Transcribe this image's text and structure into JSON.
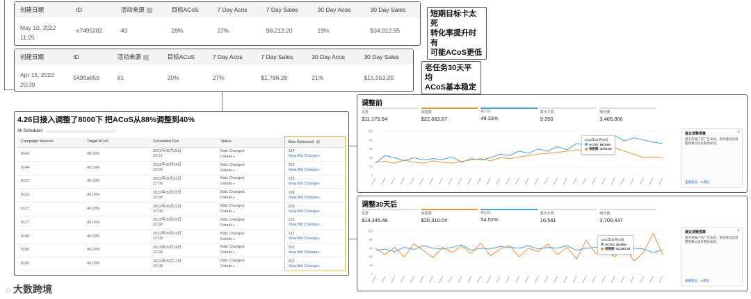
{
  "table1": {
    "headers": [
      "创建日期",
      "ID",
      "活动来源",
      "目标ACoS",
      "7 Day Acos",
      "7 Day Sales",
      "30 Day Acos",
      "30 Day Sales"
    ],
    "date": "May 10, 2022",
    "time": "11:25",
    "id": "e7495282",
    "source": "43",
    "target": "28%",
    "acos7": "27%",
    "sales7": "$8,212.20",
    "acos30": "19%",
    "sales30": "$34,812.95"
  },
  "note1": "短期目标卡太死\n转化率提升时有\n可能ACoS更低",
  "table2": {
    "headers": [
      "创建日期",
      "ID",
      "活动来源",
      "目标ACoS",
      "7 Day Acos",
      "7 Day Sales",
      "30 Day Acos",
      "30 Day Sales"
    ],
    "date": "Apr 15, 2022",
    "time": "20:39",
    "id": "5499a65b",
    "source": "81",
    "target": "20%",
    "acos7": "27%",
    "sales7": "$1,786.28",
    "acos30": "21%",
    "sales30": "$15,553.20"
  },
  "note2": "老任务30天平均\nACoS基本稳定",
  "schedule": {
    "title": "4.26日接入调整了8000下 把ACoS从88%调整到40%",
    "tab": "All Schedules",
    "headers": [
      "Campaign Sources",
      "Target ACoS",
      "Scheduled Run",
      "Status",
      "Bids Optimized"
    ],
    "rows": [
      {
        "source": "9144",
        "target": "40.00%",
        "run1": "2022年05月25日",
        "run2": "23:01",
        "status1": "Bids Changed",
        "status2": "Details",
        "count": "194",
        "link": "View Bid Changes"
      },
      {
        "source": "9144",
        "target": "40.00%",
        "run1": "2022年05月24日",
        "run2": "22:08",
        "status1": "Bids Changed",
        "status2": "Details",
        "count": "202",
        "link": "View Bid Changes"
      },
      {
        "source": "9137",
        "target": "40.00%",
        "run1": "2022年05月23日",
        "run2": "22:08",
        "status1": "Bids Changed",
        "status2": "Details",
        "count": "195",
        "link": "View Bid Changes"
      },
      {
        "source": "9133",
        "target": "40.00%",
        "run1": "2022年05月22日",
        "run2": "22:08",
        "status1": "Bids Changed",
        "status2": "Details",
        "count": "198",
        "link": "View Bid Changes"
      },
      {
        "source": "9127",
        "target": "40.00%",
        "run1": "2022年05月21日",
        "run2": "22:08",
        "status1": "Bids Changed",
        "status2": "Details",
        "count": "209",
        "link": "View Bid Changes"
      },
      {
        "source": "9127",
        "target": "40.00%",
        "run1": "2022年05月20日",
        "run2": "22:08",
        "status1": "Bids Changed",
        "status2": "Details",
        "count": "223",
        "link": "View Bid Changes"
      },
      {
        "source": "9108",
        "target": "40.00%",
        "run1": "2022年05月19日",
        "run2": "22:08",
        "status1": "Bids Changed",
        "status2": "Details",
        "count": "197",
        "link": "View Bid Changes"
      },
      {
        "source": "9106",
        "target": "40.00%",
        "run1": "2022年05月18日",
        "run2": "22:08",
        "status1": "Bids Changed",
        "status2": "Details",
        "count": "202",
        "link": "View Bid Changes"
      },
      {
        "source": "9106",
        "target": "40.00%",
        "run1": "2022年05月17日",
        "run2": "22:08",
        "status1": "Bids Changed",
        "status2": "Details",
        "count": "203",
        "link": "View Bid Changes"
      }
    ]
  },
  "before": {
    "title": "调整前",
    "metrics": [
      {
        "label": "花费",
        "value": "$11,179.54"
      },
      {
        "label": "销售额",
        "value": "$22,663.67"
      },
      {
        "label": "ACOS",
        "value": "49.33%"
      },
      {
        "label": "展示次数",
        "value": "9,350"
      },
      {
        "label": "曝光量",
        "value": "3,465,006"
      }
    ],
    "tooltip": {
      "date": "2022年04月25日",
      "acos": "ACOS: 88.24%",
      "sales": "销售额: $700.65"
    },
    "card": {
      "title": "建议调整预算",
      "text": "基于您账户的广告表现，系统建议您调整预算以提升整体表现。",
      "link": "查看建议",
      "tag": "AI建议"
    }
  },
  "after": {
    "title": "调整30天后",
    "metrics": [
      {
        "label": "花费",
        "value": "$14,345.46"
      },
      {
        "label": "销售额",
        "value": "$26,310.04"
      },
      {
        "label": "ACOS",
        "value": "54.52%"
      },
      {
        "label": "展示次数",
        "value": "10,561"
      },
      {
        "label": "曝光量",
        "value": "3,700,437"
      }
    ],
    "tooltip": {
      "date": "2022年05月24日",
      "acos": "ACOS: 45.46%",
      "sales": "销售额: $1,383.33"
    },
    "card": {
      "title": "建议调整预算",
      "text": "基于您账户的广告表现，系统建议您调整预算以提升整体表现。",
      "link": "查看建议",
      "tag": "AI建议"
    }
  },
  "logo": "大数跨境",
  "chart_data": [
    {
      "type": "line",
      "title": "调整前",
      "series": [
        {
          "name": "销售额",
          "values": [
            28,
            45,
            40,
            33,
            40,
            35,
            38,
            36,
            42,
            30,
            38,
            35,
            40,
            48,
            45,
            55,
            50,
            60,
            55,
            65,
            58,
            72,
            68,
            80,
            60,
            90,
            78,
            85,
            80,
            75,
            72
          ]
        },
        {
          "name": "ACOS",
          "values": [
            30,
            32,
            28,
            35,
            30,
            28,
            33,
            30,
            28,
            32,
            35,
            38,
            33,
            40,
            38,
            42,
            45,
            48,
            50,
            52,
            55,
            58,
            55,
            60,
            58,
            62,
            55,
            48,
            40,
            42,
            40
          ]
        }
      ],
      "ylim": [
        0,
        100
      ]
    },
    {
      "type": "line",
      "title": "调整30天后",
      "series": [
        {
          "name": "销售额",
          "values": [
            55,
            58,
            52,
            62,
            57,
            66,
            60,
            58,
            62,
            68,
            55,
            60,
            58,
            64,
            62,
            60,
            66,
            58,
            62,
            60,
            66,
            55,
            60,
            62,
            58,
            64,
            55,
            60,
            58,
            50,
            56
          ]
        },
        {
          "name": "ACOS",
          "values": [
            60,
            45,
            62,
            40,
            70,
            55,
            38,
            62,
            50,
            65,
            48,
            72,
            42,
            58,
            66,
            40,
            60,
            52,
            70,
            45,
            62,
            35,
            78,
            48,
            55,
            40,
            66,
            30,
            50,
            95,
            45
          ]
        }
      ],
      "ylim": [
        0,
        100
      ]
    }
  ]
}
